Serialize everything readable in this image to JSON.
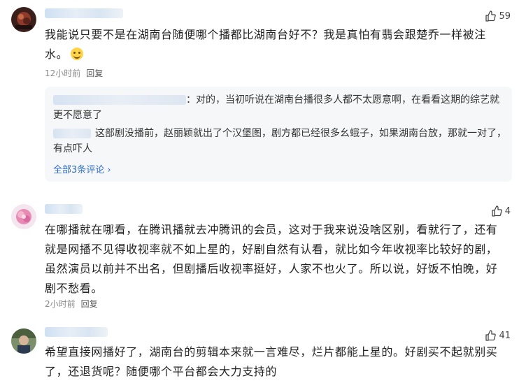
{
  "comments": [
    {
      "likes": "59",
      "text": "我能说只要不是在湖南台随便哪个播都比湖南台好不？我是真怕有翡会跟楚乔一样被注水。",
      "time": "12小时前",
      "reply_label": "回复",
      "replies": [
        {
          "text": "：对的，当初听说在湖南台播很多人都不太愿意啊，在看看这期的综艺就更不愿意了"
        },
        {
          "text": "这部剧没播前，赵丽颖就出了个汉堡图，剧方都已经很多幺蛾子，如果湖南台放，那就一对了，有点吓人"
        }
      ],
      "see_all": "全部3条评论 ›"
    },
    {
      "likes": "4",
      "text": "在哪播就在哪看，在腾讯播就去冲腾讯的会员，这对于我来说没啥区别，看就行了，还有就是网播不见得收视率就不如上星的，好剧自然有认看，就比如今年收视率比较好的剧，虽然演员以前并不出名，但剧播后收视率挺好，人家不也火了。所以说，好饭不怕晚，好剧不愁看。",
      "time": "2小时前",
      "reply_label": "回复"
    },
    {
      "likes": "41",
      "text": "希望直接网播好了，湖南台的剪辑本来就一言难尽，烂片都能上星的。好剧买不起就别买了，还退货呢？随便哪个平台都会大力支持的"
    }
  ],
  "colors": {
    "link": "#2f6cc9",
    "meta": "#8a8a8a",
    "reply_bg": "#f6f7f8"
  }
}
